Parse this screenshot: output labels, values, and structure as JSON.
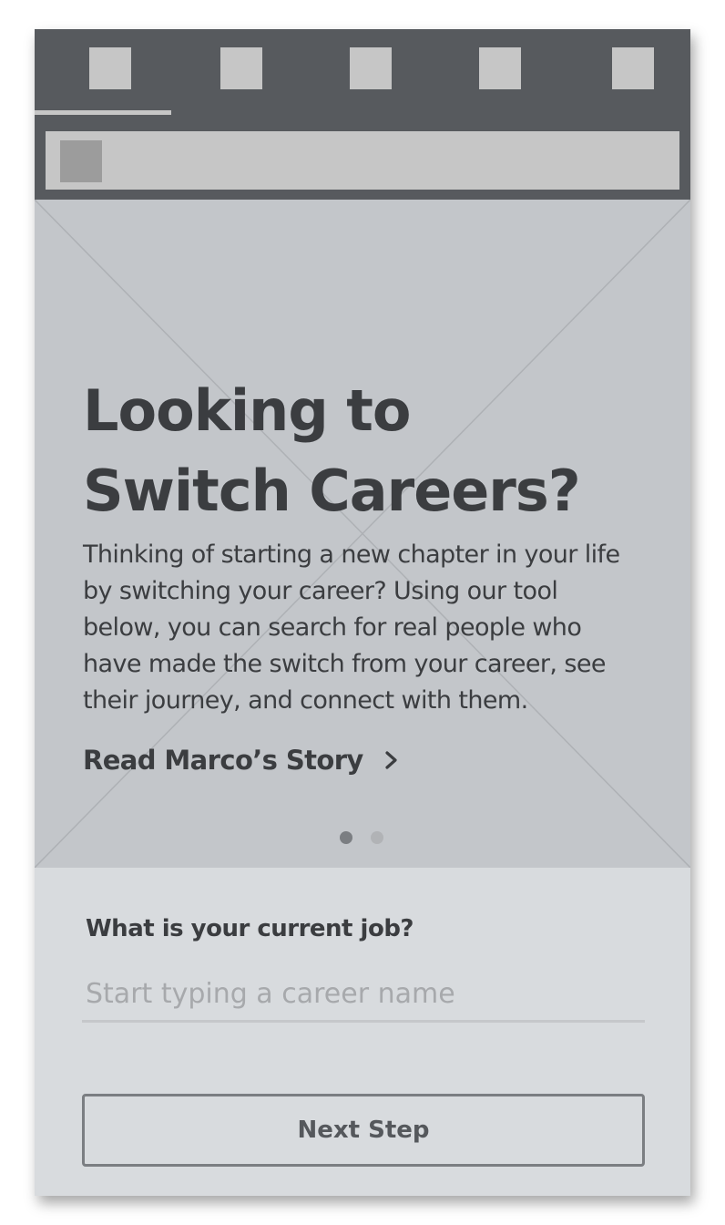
{
  "nav": {
    "tabs": [
      {
        "icon": "placeholder-icon"
      },
      {
        "icon": "placeholder-icon"
      },
      {
        "icon": "placeholder-icon"
      },
      {
        "icon": "placeholder-icon"
      },
      {
        "icon": "placeholder-icon"
      }
    ],
    "active_tab": 0
  },
  "search": {
    "icon": "placeholder-icon"
  },
  "hero": {
    "title_line1": "Looking to",
    "title_line2": "Switch Careers?",
    "body": "Thinking of starting a new chapter in your life by switching your career? Using our tool below, you can search for real people who have made the switch from your career, see their journey, and connect with them.",
    "link_label": "Read Marco’s Story",
    "link_icon": "chevron-right-icon",
    "carousel_pages": 2,
    "carousel_active": 0
  },
  "form": {
    "question": "What is your current job?",
    "placeholder": "Start typing a career name",
    "value": "",
    "next_label": "Next Step"
  },
  "colors": {
    "topbar": "#575a5e",
    "hero_bg": "#c3c6ca",
    "form_bg": "#d8dbde",
    "text": "#3b3d40"
  }
}
